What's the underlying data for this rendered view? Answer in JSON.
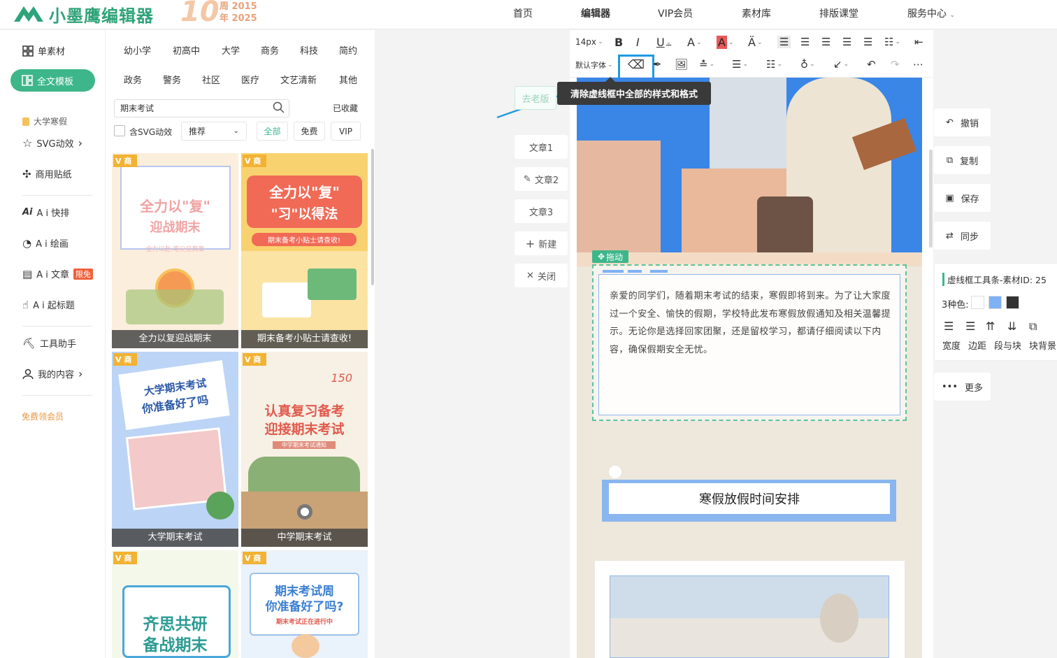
{
  "brand": {
    "logo_text": "小墨鹰编辑器",
    "anniv_number": "10",
    "anniv_line1": "周 2015",
    "anniv_line2": "年 2025",
    "colors": {
      "brand_green": "#3db78a",
      "highlight_blue": "#1d9be3"
    }
  },
  "nav": [
    "首页",
    "编辑器",
    "VIP会员",
    "素材库",
    "排版课堂",
    "服务中心"
  ],
  "nav_active": "编辑器",
  "sidebar": {
    "items": [
      {
        "label": "单素材",
        "icon": "grid-icon"
      },
      {
        "label": "全文模板",
        "icon": "layout-icon"
      },
      {
        "label": "大学寒假",
        "icon": "bag-icon"
      },
      {
        "label": "SVG动效",
        "icon": "star-icon"
      },
      {
        "label": "商用贴纸",
        "icon": "puzzle-icon"
      },
      {
        "label": "A i 快排",
        "icon": "ai-icon"
      },
      {
        "label": "A i 绘画",
        "icon": "palette-icon"
      },
      {
        "label": "A i 文章",
        "icon": "doc-icon"
      },
      {
        "label": "A i 起标题",
        "icon": "hand-icon"
      },
      {
        "label": "工具助手",
        "icon": "tools-icon"
      },
      {
        "label": "我的内容",
        "icon": "user-icon"
      }
    ],
    "ai_article_badge": "限免",
    "free_vip": "免费领会员",
    "chevron": "›"
  },
  "templates": {
    "categories_row1": [
      "幼小学",
      "初高中",
      "大学",
      "商务",
      "科技",
      "简约"
    ],
    "categories_row2": [
      "政务",
      "警务",
      "社区",
      "医疗",
      "文艺清新",
      "其他"
    ],
    "search_value": "期末考试",
    "favorites": "已收藏",
    "svg_checkbox": "含SVG动效",
    "sort_select": "推荐",
    "filters": [
      "全部",
      "免费",
      "VIP"
    ],
    "badge": "V 商",
    "cards": [
      {
        "caption": "全力以复迎战期末",
        "title1": "全力以\"复\"",
        "title2": "迎战期末",
        "sub": "全力以赴,笔尖见真章"
      },
      {
        "caption": "期末备考小贴士请查收!",
        "title1": "全力以\"复\"",
        "title2": "\"习\"以得法",
        "sub": "期末备考小贴士请查收!"
      },
      {
        "caption": "大学期末考试",
        "title1": "大学期末考试",
        "title2": "你准备好了吗",
        "sub": ""
      },
      {
        "caption": "中学期末考试",
        "title1": "认真复习备考",
        "title2": "迎接期末考试",
        "sub": "中学期末考试通知",
        "extra": "150"
      },
      {
        "caption": "",
        "title1": "齐思共研",
        "title2": "备战期末",
        "sub": ""
      },
      {
        "caption": "",
        "title1": "期末考试周",
        "title2": "你准备好了吗?",
        "sub": "期末考试正在进行中"
      }
    ]
  },
  "articles": {
    "go_btn": "去老版",
    "items": [
      "文章1",
      "文章2",
      "文章3"
    ],
    "new": "新建",
    "close": "关闭"
  },
  "toolbar": {
    "font_size": "14px",
    "font_family": "默认字体",
    "tooltip": "清除虚线框中全部的样式和格式"
  },
  "canvas": {
    "drag_label": "拖动",
    "paragraph": "亲爱的同学们，随着期末考试的结束，寒假即将到来。为了让大家度过一个安全、愉快的假期，学校特此发布寒假放假通知及相关温馨提示。无论你是选择回家团聚，还是留校学习，都请仔细阅读以下内容，确保假期安全无忧。",
    "section_title": "寒假放假时间安排"
  },
  "right_panel": {
    "buttons": [
      "撤销",
      "复制",
      "保存",
      "同步"
    ],
    "more": "更多",
    "dash_title": "虚线框工具条-素材ID: 25",
    "color_label": "3种色:",
    "swatches": [
      "#ffffff",
      "#7fb1f5",
      "#333333"
    ],
    "tools": [
      "宽度",
      "边距",
      "段与块",
      "块背景"
    ]
  }
}
